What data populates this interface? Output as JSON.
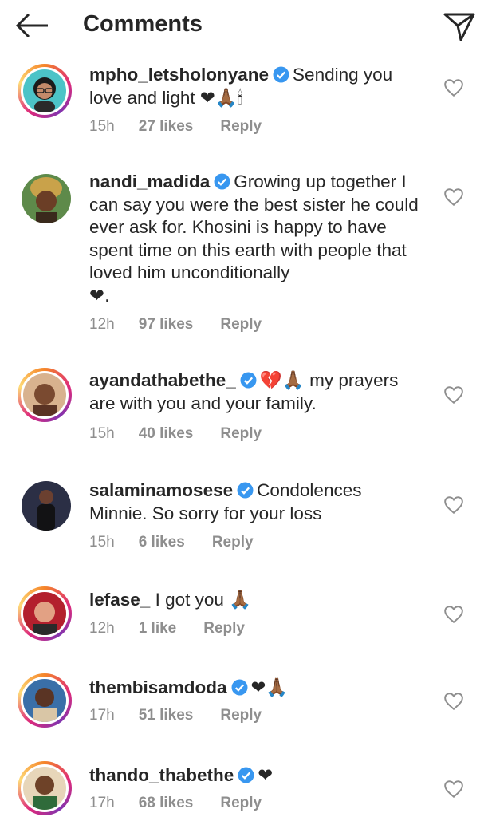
{
  "header": {
    "title": "Comments",
    "back_icon": "arrow-left-icon",
    "send_icon": "paper-plane-icon"
  },
  "comments": [
    {
      "username": "mpho_letsholonyane",
      "verified": true,
      "text": "Sending you love and light",
      "emoji": "❤🙏🏾🕯",
      "time": "15h",
      "likes": "27 likes",
      "reply": "Reply",
      "story_ring": true
    },
    {
      "username": "nandi_madida",
      "verified": true,
      "text": "Growing up together I can say you were the best sister he could ever ask for. Khosini is happy to have spent time on this earth with people that loved him unconditionally",
      "emoji": "❤.",
      "time": "12h",
      "likes": "97 likes",
      "reply": "Reply",
      "story_ring": false
    },
    {
      "username": "ayandathabethe_",
      "verified": true,
      "text": "my prayers are with you and your family.",
      "emoji": "💔🙏🏾",
      "time": "15h",
      "likes": "40 likes",
      "reply": "Reply",
      "story_ring": true
    },
    {
      "username": "salaminamosese",
      "verified": true,
      "text": "Condolences Minnie. So sorry for your loss",
      "emoji": "",
      "time": "15h",
      "likes": "6 likes",
      "reply": "Reply",
      "story_ring": false
    },
    {
      "username": "lefase_",
      "verified": false,
      "text": "I got you",
      "emoji": "🙏🏾",
      "time": "12h",
      "likes": "1 like",
      "reply": "Reply",
      "story_ring": true
    },
    {
      "username": "thembisamdoda",
      "verified": true,
      "text": "",
      "emoji": "❤🙏🏾",
      "time": "17h",
      "likes": "51 likes",
      "reply": "Reply",
      "story_ring": true
    },
    {
      "username": "thando_thabethe",
      "verified": true,
      "text": "",
      "emoji": "❤",
      "time": "17h",
      "likes": "68 likes",
      "reply": "Reply",
      "story_ring": true
    }
  ],
  "colors": {
    "verified_blue": "#3897f0",
    "muted": "#8e8e8e",
    "heart_red": "#e0162b"
  }
}
